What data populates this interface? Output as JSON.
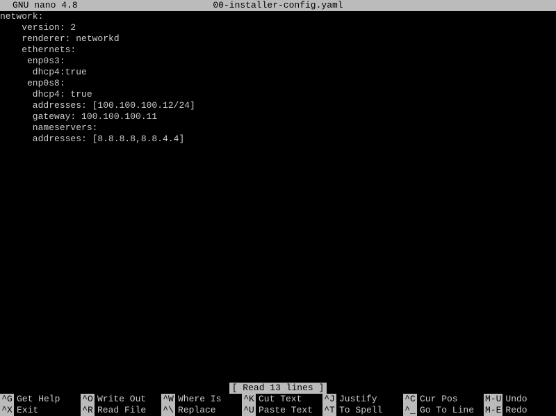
{
  "title": {
    "app": "GNU nano 4.8",
    "filename": "00-installer-config.yaml"
  },
  "content_lines": [
    "network:",
    "    version: 2",
    "    renderer: networkd",
    "    ethernets:",
    "     enp0s3:",
    "      dhcp4:true",
    "     enp0s8:",
    "      dhcp4: true",
    "      addresses: [100.100.100.12/24]",
    "      gateway: 100.100.100.11",
    "      nameservers:",
    "      addresses: [8.8.8.8,8.8.4.4]"
  ],
  "status": "[ Read 13 lines ]",
  "shortcuts": {
    "row1": [
      {
        "key": "^G",
        "label": "Get Help"
      },
      {
        "key": "^O",
        "label": "Write Out"
      },
      {
        "key": "^W",
        "label": "Where Is"
      },
      {
        "key": "^K",
        "label": "Cut Text"
      },
      {
        "key": "^J",
        "label": "Justify"
      },
      {
        "key": "^C",
        "label": "Cur Pos"
      },
      {
        "key": "M-U",
        "label": "Undo"
      }
    ],
    "row2": [
      {
        "key": "^X",
        "label": "Exit"
      },
      {
        "key": "^R",
        "label": "Read File"
      },
      {
        "key": "^\\",
        "label": "Replace"
      },
      {
        "key": "^U",
        "label": "Paste Text"
      },
      {
        "key": "^T",
        "label": "To Spell"
      },
      {
        "key": "^_",
        "label": "Go To Line"
      },
      {
        "key": "M-E",
        "label": "Redo"
      }
    ]
  }
}
